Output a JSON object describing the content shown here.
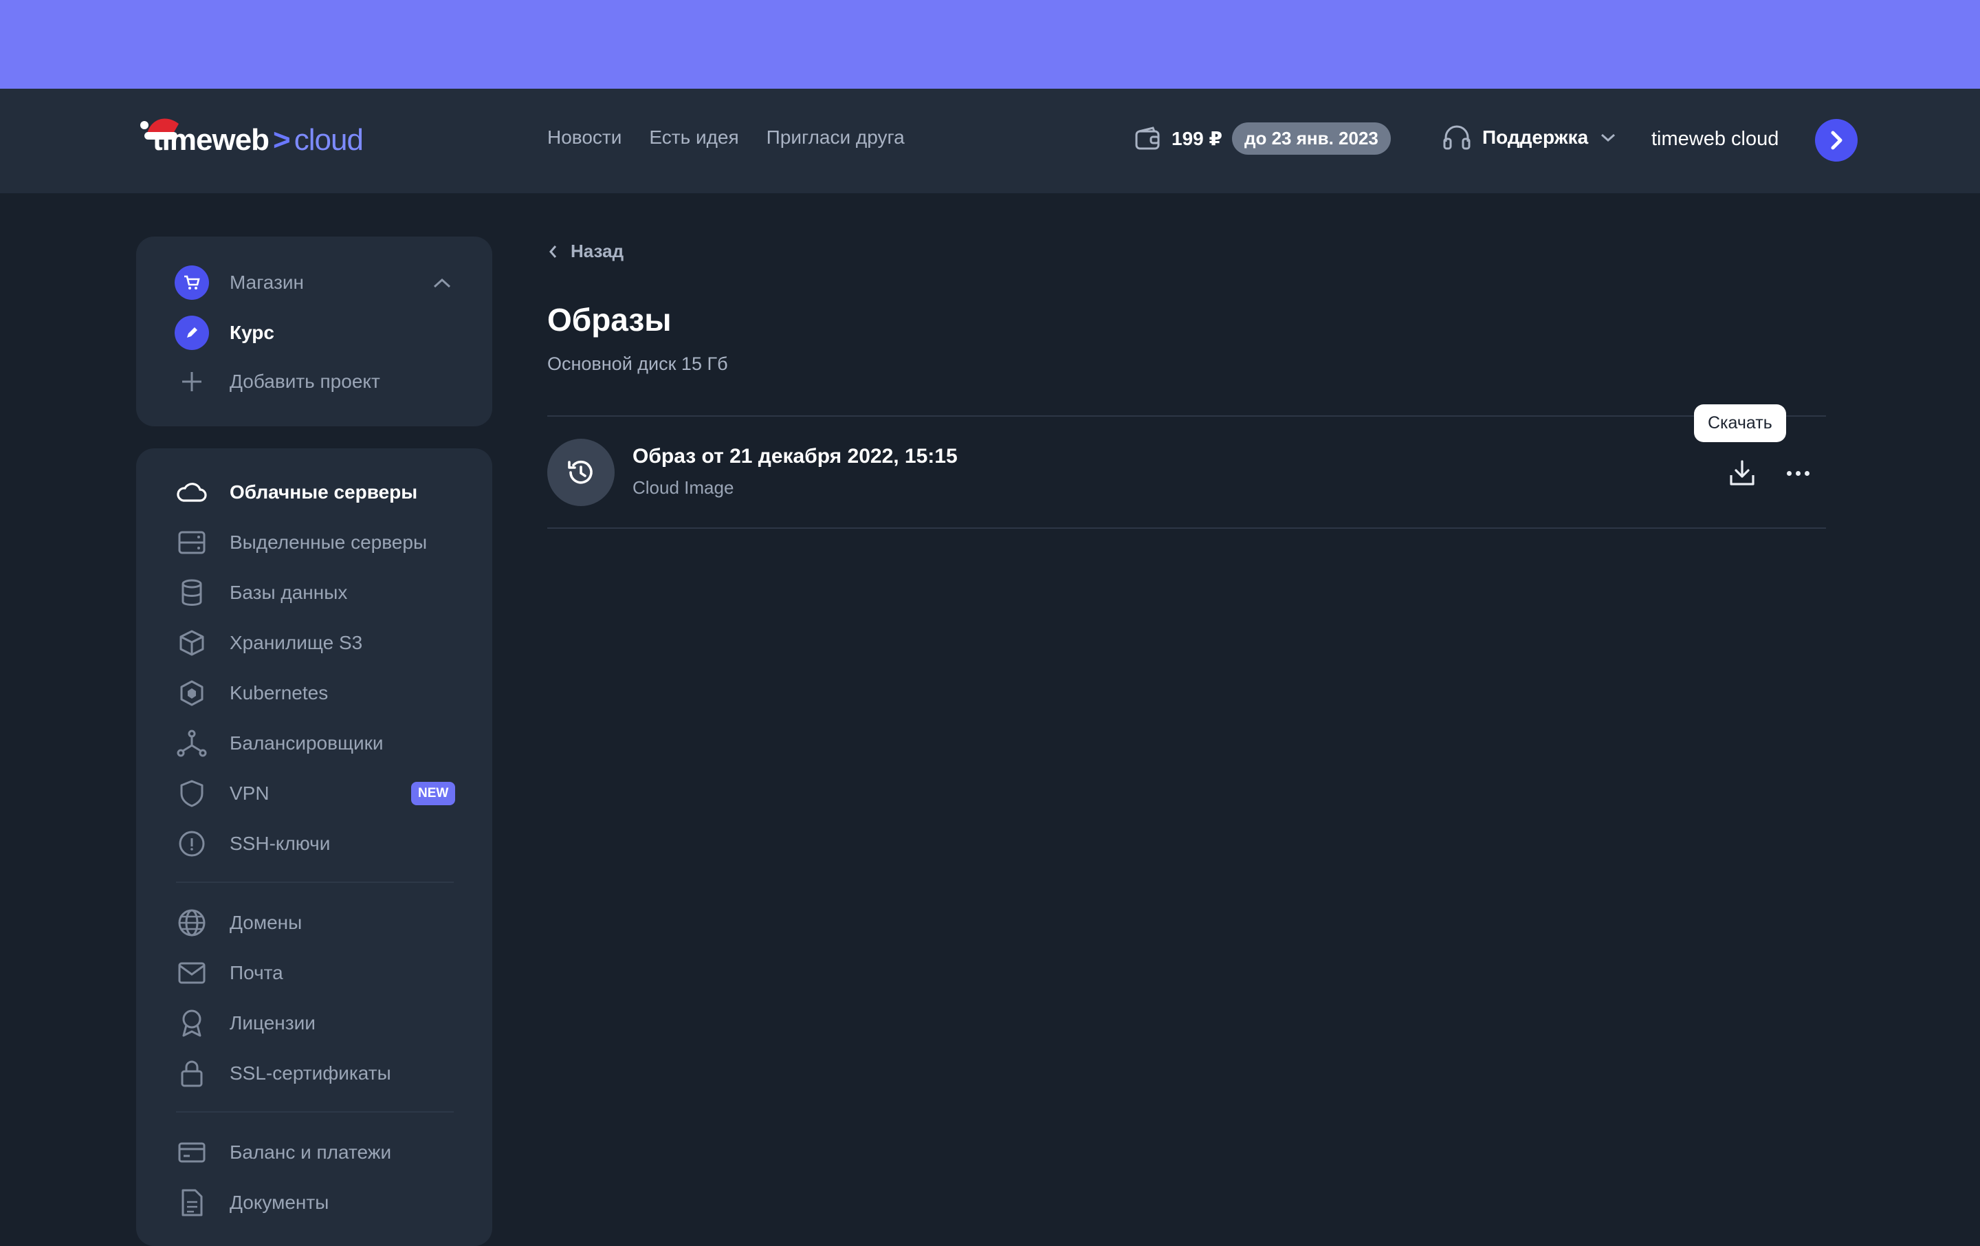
{
  "header": {
    "logo": {
      "word1": "timeweb",
      "separator": ">",
      "word2": "cloud"
    },
    "nav": [
      "Новости",
      "Есть идея",
      "Пригласи друга"
    ],
    "balance": {
      "amount": "199 ₽",
      "until": "до 23 янв. 2023"
    },
    "support_label": "Поддержка",
    "account_name": "timeweb cloud"
  },
  "projects": {
    "items": [
      {
        "label": "Магазин",
        "icon": "cart-icon"
      },
      {
        "label": "Курс",
        "icon": "pencil-icon"
      },
      {
        "label": "Добавить проект",
        "icon": "plus-icon"
      }
    ]
  },
  "sidebar": {
    "items": [
      {
        "label": "Облачные серверы",
        "icon": "cloud-icon"
      },
      {
        "label": "Выделенные серверы",
        "icon": "server-icon"
      },
      {
        "label": "Базы данных",
        "icon": "database-icon"
      },
      {
        "label": "Хранилище S3",
        "icon": "cube-icon"
      },
      {
        "label": "Kubernetes",
        "icon": "kubernetes-icon"
      },
      {
        "label": "Балансировщики",
        "icon": "balancer-icon"
      },
      {
        "label": "VPN",
        "icon": "shield-icon",
        "badge": "NEW"
      },
      {
        "label": "SSH-ключи",
        "icon": "key-icon"
      },
      {
        "label": "Домены",
        "icon": "globe-icon"
      },
      {
        "label": "Почта",
        "icon": "mail-icon"
      },
      {
        "label": "Лицензии",
        "icon": "award-icon"
      },
      {
        "label": "SSL-сертификаты",
        "icon": "lock-icon"
      },
      {
        "label": "Баланс и платежи",
        "icon": "card-icon"
      },
      {
        "label": "Документы",
        "icon": "document-icon"
      }
    ]
  },
  "main": {
    "back_label": "Назад",
    "title": "Образы",
    "subtitle": "Основной диск 15 Гб",
    "images": [
      {
        "title": "Образ от 21 декабря 2022, 15:15",
        "type": "Cloud Image"
      }
    ],
    "tooltip": "Скачать"
  },
  "colors": {
    "banner": "#7479f8",
    "header": "#232d3b",
    "background": "#18202b",
    "accent": "#4c52f3"
  }
}
